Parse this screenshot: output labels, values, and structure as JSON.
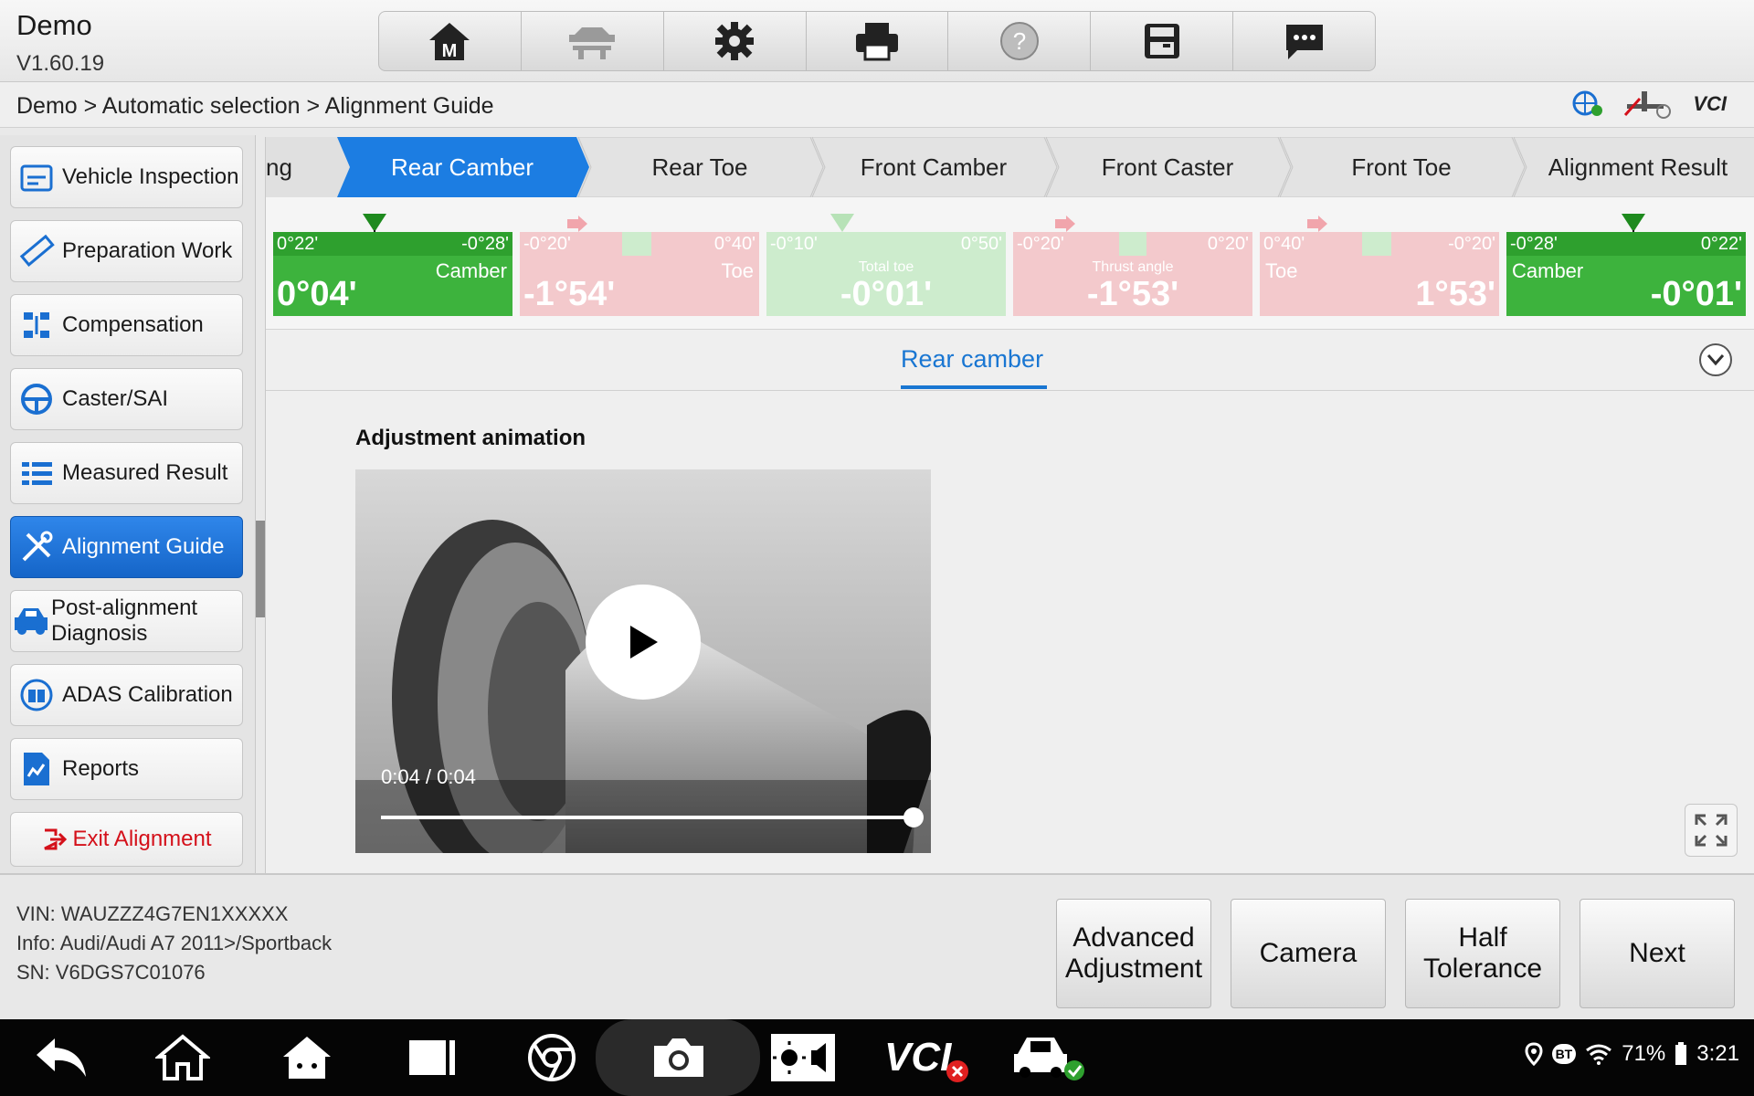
{
  "header": {
    "title": "Demo",
    "version": "V1.60.19"
  },
  "toolbar": {
    "items": [
      {
        "name": "home-m",
        "label": "M"
      },
      {
        "name": "vehicle-lift"
      },
      {
        "name": "settings"
      },
      {
        "name": "print"
      },
      {
        "name": "help",
        "label": "?"
      },
      {
        "name": "save"
      },
      {
        "name": "messages"
      }
    ]
  },
  "breadcrumb": "Demo > Automatic selection > Alignment Guide",
  "status": {
    "vci": "VCI"
  },
  "sidebar": {
    "items": [
      {
        "label": "Vehicle Inspection"
      },
      {
        "label": "Preparation Work"
      },
      {
        "label": "Compensation"
      },
      {
        "label": "Caster/SAI"
      },
      {
        "label": "Measured Result"
      },
      {
        "label": "Alignment Guide",
        "active": true
      },
      {
        "label": "Post-alignment Diagnosis"
      },
      {
        "label": "ADAS Calibration"
      },
      {
        "label": "Reports"
      }
    ],
    "exit_label": "Exit Alignment"
  },
  "steps": {
    "cut": "ng",
    "items": [
      "Rear Camber",
      "Rear Toe",
      "Front Camber",
      "Front Caster",
      "Front Toe",
      "Alignment Result"
    ],
    "active_index": 0
  },
  "gauges": [
    {
      "lo": "0°22'",
      "hi": "-0°28'",
      "name": "Camber",
      "value": "0°04'",
      "state": "ok"
    },
    {
      "lo": "-0°20'",
      "hi": "0°40'",
      "name": "Toe",
      "value": "-1°54'",
      "state": "bad"
    },
    {
      "lo": "-0°10'",
      "hi": "0°50'",
      "name": "Total toe",
      "value": "-0°01'",
      "state": "mid"
    },
    {
      "lo": "-0°20'",
      "hi": "0°20'",
      "name": "Thrust angle",
      "value": "-1°53'",
      "state": "bad"
    },
    {
      "lo": "0°40'",
      "hi": "-0°20'",
      "name": "Toe",
      "value": "1°53'",
      "state": "bad"
    },
    {
      "lo": "-0°28'",
      "hi": "0°22'",
      "name": "Camber",
      "value": "-0°01'",
      "state": "ok"
    }
  ],
  "subtab": "Rear camber",
  "animation": {
    "title": "Adjustment animation",
    "time": "0:04 / 0:04",
    "progress": 1.0
  },
  "footer": {
    "vin": "VIN: WAUZZZ4G7EN1XXXXX",
    "info": "Info: Audi/Audi A7 2011>/Sportback",
    "sn": "SN: V6DGS7C01076",
    "buttons": [
      "Advanced Adjustment",
      "Camera",
      "Half Tolerance",
      "Next"
    ]
  },
  "system": {
    "battery": "71%",
    "clock": "3:21",
    "bt": "BT",
    "vci": "VCI"
  },
  "colors": {
    "accent": "#1976d2",
    "ok": "#3db33d",
    "bad": "#f3c9cc",
    "exit": "#d4101a"
  }
}
